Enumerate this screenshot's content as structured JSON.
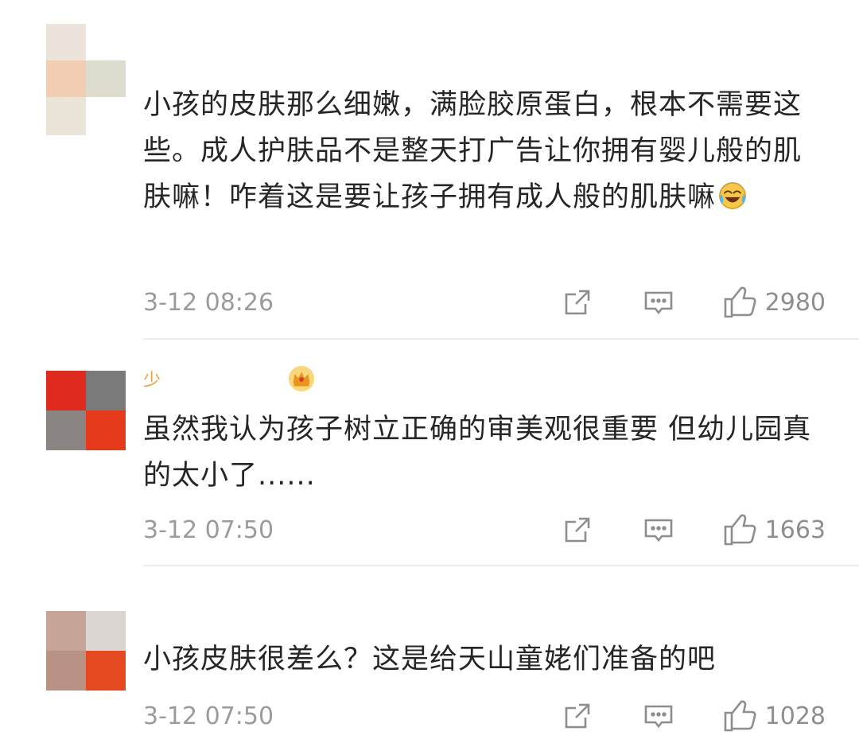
{
  "colors": {
    "text": "#262626",
    "meta": "#9b9b9b",
    "username": "#e8a341",
    "divider": "#ececec"
  },
  "comments": [
    {
      "username": "",
      "text": "小孩的皮肤那么细嫩，满脸胶原蛋白，根本不需要这些。成人护肤品不是整天打广告让你拥有婴儿般的肌肤嘛！咋着这是要让孩子拥有成人般的肌肤嘛",
      "emoji": "laugh-cry-icon",
      "time": "3-12 08:26",
      "likes": "2980"
    },
    {
      "username": "少",
      "badge": "crown-icon",
      "text": "虽然我认为孩子树立正确的审美观很重要 但幼儿园真的太小了......",
      "time": "3-12 07:50",
      "likes": "1663"
    },
    {
      "username": "",
      "text": "小孩皮肤很差么？这是给天山童姥们准备的吧",
      "time": "3-12 07:50",
      "likes": "1028"
    }
  ]
}
